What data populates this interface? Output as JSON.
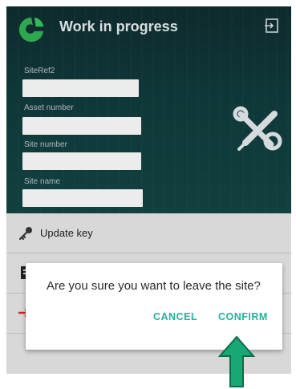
{
  "header": {
    "title": "Work in progress",
    "logo_icon": "leaf-logo-icon",
    "logout_icon": "logout-icon"
  },
  "fields": [
    {
      "label": "SiteRef2",
      "value": ""
    },
    {
      "label": "Asset number",
      "value": ""
    },
    {
      "label": "Site number",
      "value": ""
    },
    {
      "label": "Site name",
      "value": ""
    }
  ],
  "list": {
    "items": [
      {
        "label": "Update key",
        "icon": "key-icon"
      }
    ]
  },
  "dialog": {
    "message": "Are you sure you want to leave the site?",
    "cancel_label": "CANCEL",
    "confirm_label": "CONFIRM"
  },
  "colors": {
    "accent": "#1fb39a",
    "logo_green": "#2ea84f",
    "arrow_green": "#17a874",
    "header_bg": "#0f3638"
  }
}
